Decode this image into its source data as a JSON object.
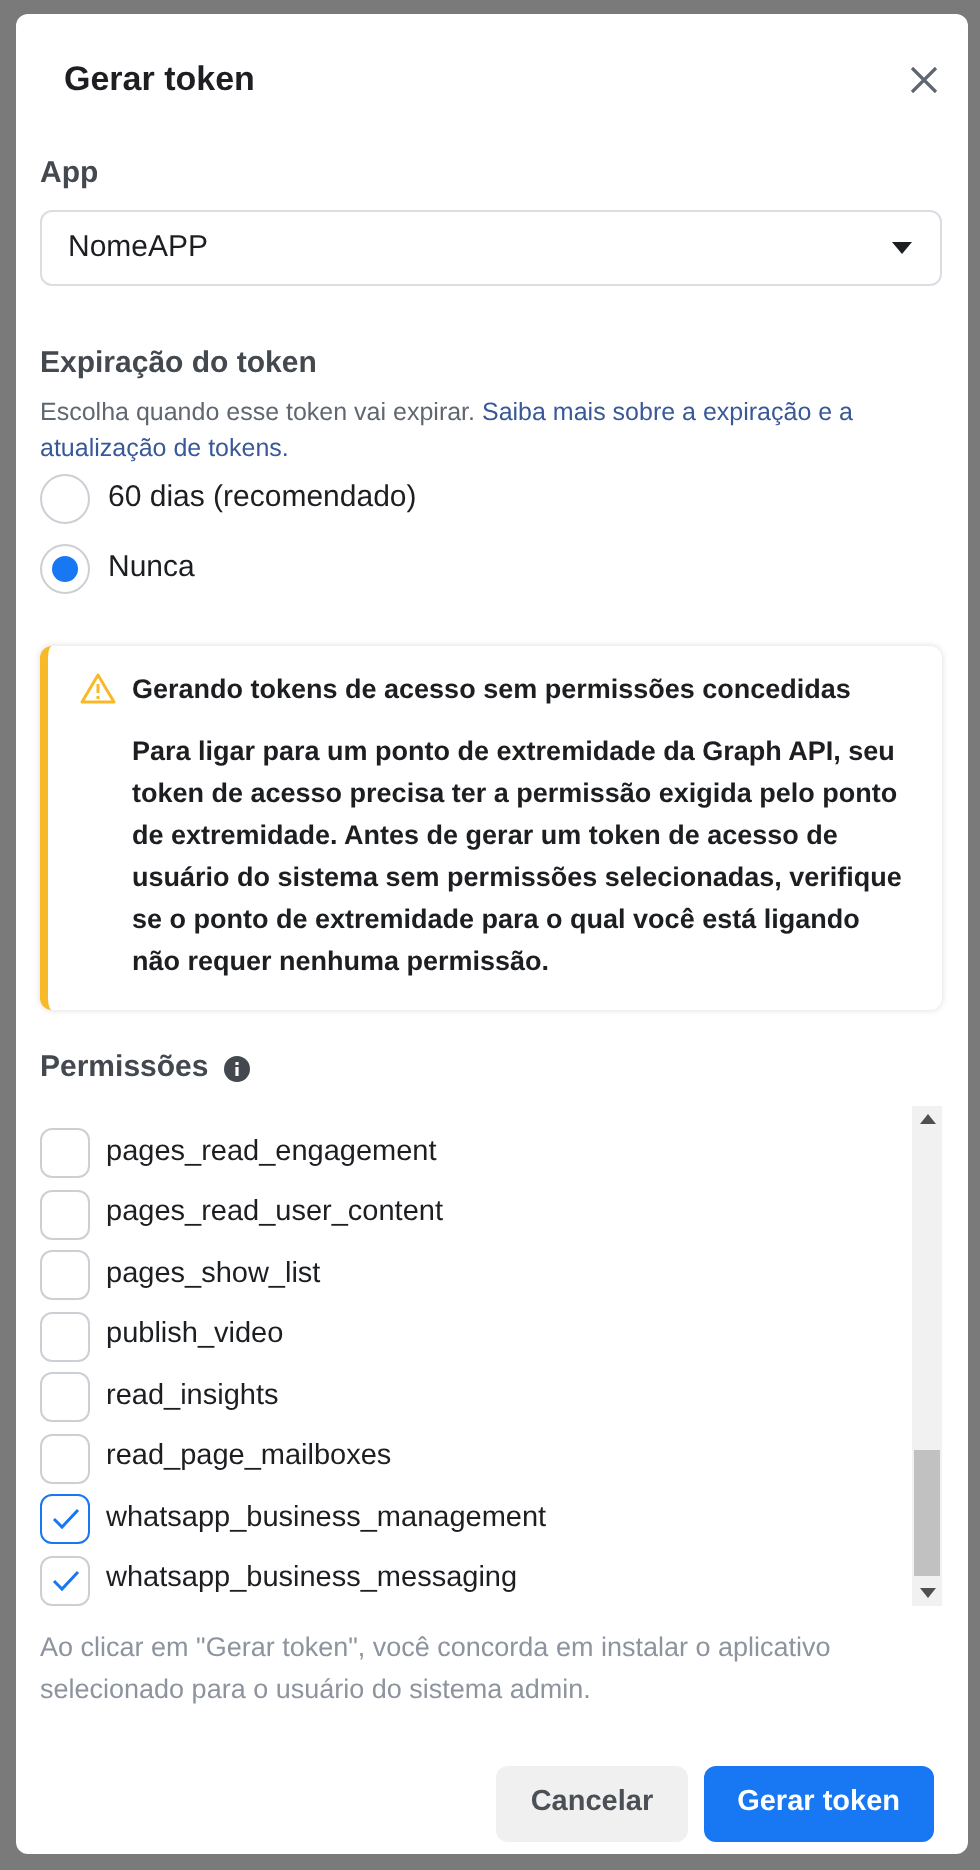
{
  "dialog": {
    "title": "Gerar token"
  },
  "app": {
    "label": "App",
    "value": "NomeAPP"
  },
  "expiration": {
    "label": "Expiração do token",
    "description": "Escolha quando esse token vai expirar.",
    "link_lines": [
      "Saiba mais sobre a expiração e a",
      "atualização de tokens."
    ],
    "options": [
      {
        "label": "60 dias (recomendado)",
        "selected": false
      },
      {
        "label": "Nunca",
        "selected": true
      }
    ]
  },
  "alert": {
    "title": "Gerando tokens de acesso sem permissões concedidas",
    "body": "Para ligar para um ponto de extremidade da Graph API, seu token de acesso precisa ter a permissão exigida pelo ponto de extremidade. Antes de gerar um token de acesso de usuário do sistema sem permissões selecionadas, verifique se o ponto de extremidade para o qual você está ligando não requer nenhuma permissão."
  },
  "permissions": {
    "label": "Permissões",
    "items": [
      {
        "label": "pages_read_engagement",
        "checked": false
      },
      {
        "label": "pages_read_user_content",
        "checked": false
      },
      {
        "label": "pages_show_list",
        "checked": false
      },
      {
        "label": "publish_video",
        "checked": false
      },
      {
        "label": "read_insights",
        "checked": false
      },
      {
        "label": "read_page_mailboxes",
        "checked": false
      },
      {
        "label": "whatsapp_business_management",
        "checked": true
      },
      {
        "label": "whatsapp_business_messaging",
        "checked": true
      }
    ]
  },
  "consent": "Ao clicar em \"Gerar token\", você concorda em instalar o aplicativo selecionado para o usuário do sistema admin.",
  "buttons": [
    {
      "label": "Cancelar",
      "kind": "secondary"
    },
    {
      "label": "Gerar token",
      "kind": "primary"
    }
  ]
}
